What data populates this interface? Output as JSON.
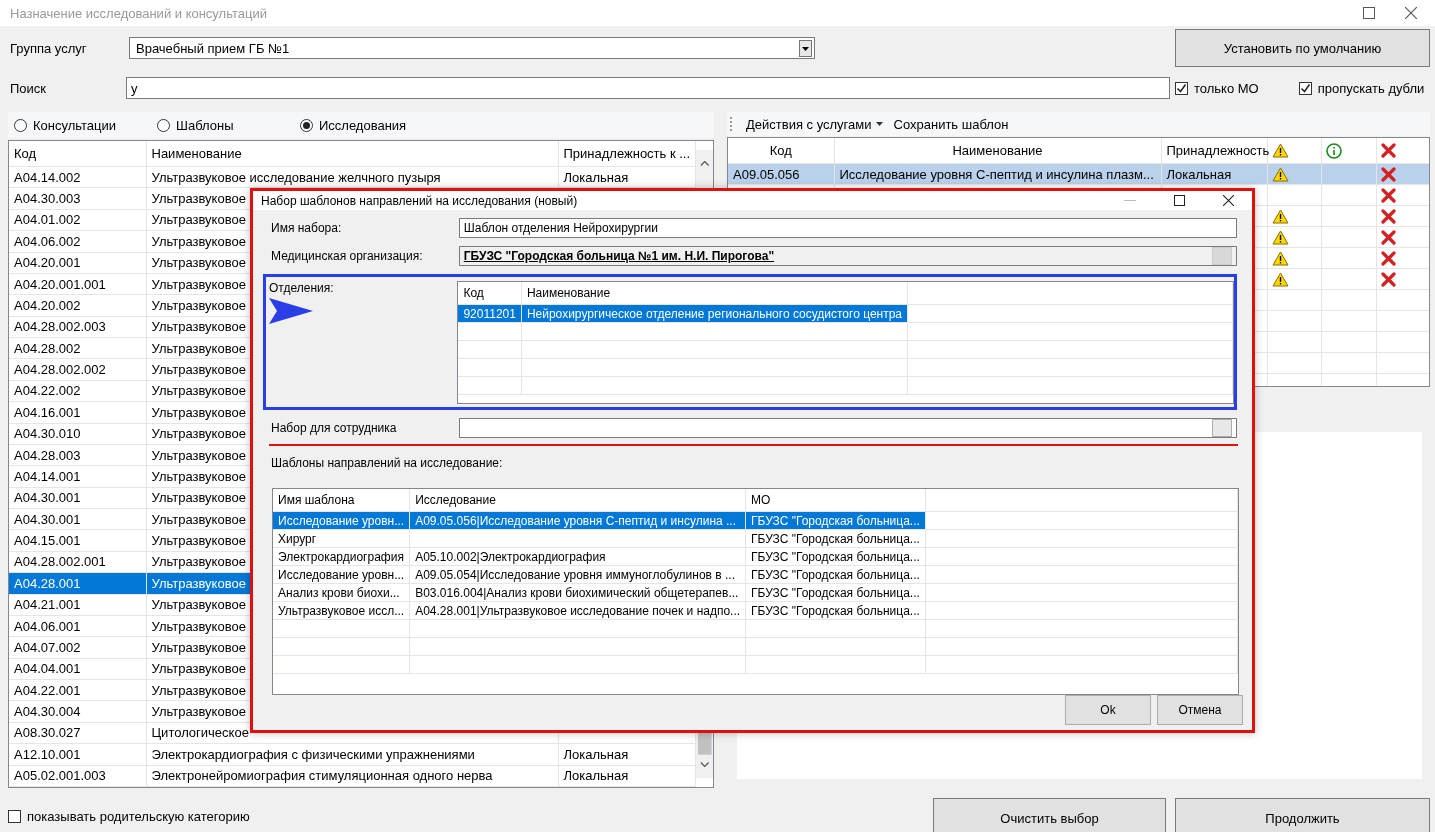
{
  "window": {
    "title": "Назначение исследований и консультаций",
    "active": false
  },
  "service_group": {
    "label": "Группа услуг",
    "value": "Врачебный прием ГБ №1"
  },
  "default_button": "Установить по умолчанию",
  "search": {
    "label": "Поиск",
    "value": "у"
  },
  "options": [
    {
      "label": "только МО",
      "checked": true
    },
    {
      "label": "пропускать дубли",
      "checked": true
    }
  ],
  "radios": [
    {
      "label": "Консультации",
      "selected": false
    },
    {
      "label": "Шаблоны",
      "selected": false
    },
    {
      "label": "Исследования",
      "selected": true
    }
  ],
  "services_table": {
    "columns": [
      "Код",
      "Наименование",
      "Принадлежность к ..."
    ],
    "rows": [
      {
        "code": "A04.14.002",
        "name": "Ультразвуковое исследование желчного пузыря",
        "owner": "Локальная",
        "selected": false
      },
      {
        "code": "A04.30.003",
        "name": "Ультразвуковое",
        "selected": false
      },
      {
        "code": "A04.01.002",
        "name": "Ультразвуковое",
        "selected": false
      },
      {
        "code": "A04.06.002",
        "name": "Ультразвуковое",
        "selected": false
      },
      {
        "code": "A04.20.001",
        "name": "Ультразвуковое",
        "selected": false
      },
      {
        "code": "A04.20.001.001",
        "name": "Ультразвуковое",
        "selected": false
      },
      {
        "code": "A04.20.002",
        "name": "Ультразвуковое",
        "selected": false
      },
      {
        "code": "A04.28.002.003",
        "name": "Ультразвуковое",
        "selected": false
      },
      {
        "code": "A04.28.002",
        "name": "Ультразвуковое",
        "selected": false
      },
      {
        "code": "A04.28.002.002",
        "name": "Ультразвуковое",
        "selected": false
      },
      {
        "code": "A04.22.002",
        "name": "Ультразвуковое",
        "selected": false
      },
      {
        "code": "A04.16.001",
        "name": "Ультразвуковое",
        "selected": false
      },
      {
        "code": "A04.30.010",
        "name": "Ультразвуковое",
        "selected": false
      },
      {
        "code": "A04.28.003",
        "name": "Ультразвуковое",
        "selected": false
      },
      {
        "code": "A04.14.001",
        "name": "Ультразвуковое",
        "selected": false
      },
      {
        "code": "A04.30.001",
        "name": "Ультразвуковое",
        "selected": false
      },
      {
        "code": "A04.30.001",
        "name": "Ультразвуковое",
        "selected": false
      },
      {
        "code": "A04.15.001",
        "name": "Ультразвуковое",
        "selected": false
      },
      {
        "code": "A04.28.002.001",
        "name": "Ультразвуковое",
        "selected": false
      },
      {
        "code": "A04.28.001",
        "name": "Ультразвуковое",
        "selected": true
      },
      {
        "code": "A04.21.001",
        "name": "Ультразвуковое",
        "selected": false
      },
      {
        "code": "A04.06.001",
        "name": "Ультразвуковое",
        "selected": false
      },
      {
        "code": "A04.07.002",
        "name": "Ультразвуковое",
        "selected": false
      },
      {
        "code": "A04.04.001",
        "name": "Ультразвуковое",
        "selected": false
      },
      {
        "code": "A04.22.001",
        "name": "Ультразвуковое",
        "selected": false
      },
      {
        "code": "A04.30.004",
        "name": "Ультразвуковое",
        "selected": false
      },
      {
        "code": "A08.30.027",
        "name": "Цитологическое",
        "selected": false
      },
      {
        "code": "A12.10.001",
        "name": "Электрокардиография с физическими упражнениями",
        "owner": "Локальная",
        "selected": false
      },
      {
        "code": "A05.02.001.003",
        "name": "Электронейромиография стимуляционная одного нерва",
        "owner": "Локальная",
        "selected": false
      }
    ]
  },
  "show_parent": {
    "label": "показывать родительскую категорию",
    "checked": false
  },
  "toolbar": [
    {
      "label": "Действия с услугами",
      "kind": "dropdown"
    },
    {
      "label": "Сохранить шаблон",
      "kind": "button"
    }
  ],
  "chosen_table": {
    "columns": [
      {
        "label": "Код",
        "kind": "text"
      },
      {
        "label": "Наименование",
        "kind": "text"
      },
      {
        "label": "Принадлежность",
        "kind": "text"
      },
      {
        "kind": "warning"
      },
      {
        "kind": "info"
      },
      {
        "kind": "delete"
      }
    ],
    "rows": [
      {
        "code": "A09.05.056",
        "name": "Исследование уровня С-пептид и инсулина плазм...",
        "owner": "Локальная",
        "warning": true,
        "delete": true,
        "selected": true
      },
      {
        "warning": false,
        "delete": true,
        "selected": false
      },
      {
        "warning": true,
        "delete": true,
        "selected": false
      },
      {
        "warning": true,
        "delete": true,
        "selected": false
      },
      {
        "warning": true,
        "delete": true,
        "selected": false
      },
      {
        "warning": true,
        "delete": true,
        "selected": false
      }
    ]
  },
  "buttons": [
    "Очистить выбор",
    "Продолжить"
  ],
  "dialog": {
    "title": "Набор шаблонов направлений на исследования (новый)",
    "name_label": "Имя набора:",
    "name_value": "Шаблон отделения Нейрохирургии",
    "org_label": "Медицинская организация:",
    "org_value": "ГБУЗС \"Городская больница №1 им. Н.И. Пирогова\"",
    "departments_label": "Отделения:",
    "departments": {
      "columns": [
        "Код",
        "Наименование"
      ],
      "rows": [
        {
          "code": "92011201",
          "name": "Нейрохирургическое отделение регионального сосудистого центра",
          "selected": true
        }
      ]
    },
    "employee_label": "Набор для сотрудника",
    "templates_label": "Шаблоны направлений на исследование:",
    "templates": {
      "columns": [
        "Имя шаблона",
        "Исследование",
        "МО"
      ],
      "rows": [
        {
          "name": "Исследование уровн...",
          "study": "A09.05.056|Исследование уровня С-пептид и инсулина ...",
          "org": "ГБУЗС \"Городская больница...",
          "selected": true
        },
        {
          "name": "Хирург",
          "org": "ГБУЗС \"Городская больница...",
          "selected": false
        },
        {
          "name": "Электрокардиография",
          "study": "A05.10.002|Электрокардиография",
          "org": "ГБУЗС \"Городская больница...",
          "selected": false
        },
        {
          "name": "Исследование уровн...",
          "study": "A09.05.054|Исследование уровня иммуноглобулинов в ...",
          "org": "ГБУЗС \"Городская больница...",
          "selected": false
        },
        {
          "name": "Анализ крови биохи...",
          "study": "B03.016.004|Анализ крови биохимический общетерапев...",
          "org": "ГБУЗС \"Городская больница...",
          "selected": false
        },
        {
          "name": "Ультразвуковое иссл...",
          "study": "A04.28.001|Ультразвуковое исследование почек и надпо...",
          "org": "ГБУЗС \"Городская больница...",
          "selected": false
        }
      ]
    },
    "buttons": [
      "Ok",
      "Отмена"
    ]
  }
}
